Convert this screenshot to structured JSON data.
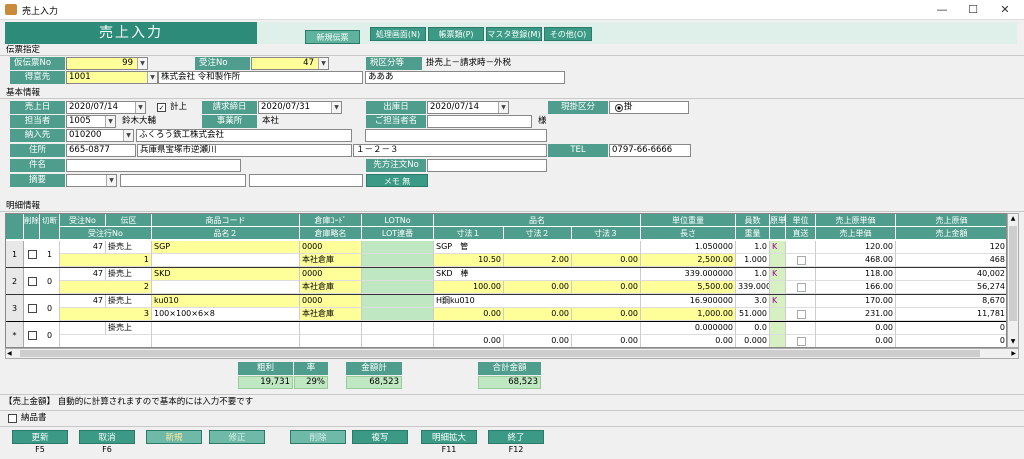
{
  "window": {
    "title": "売上入力",
    "minimize": "—",
    "maximize": "☐",
    "close": "✕"
  },
  "header": {
    "title": "売上入力",
    "new_badge": "新規伝票",
    "menu": [
      "処理画面(N)",
      "帳票類(P)",
      "マスタ登録(M)",
      "その他(O)"
    ]
  },
  "denpyo": {
    "section": "伝票指定",
    "karidenpyo_label": "仮伝票No",
    "karidenpyo_value": "99",
    "juchu_label": "受注No",
    "juchu_value": "47",
    "zeikubun_label": "税区分等",
    "zeikubun_value": "掛売上－請求時－外税",
    "tokuisaki_label": "得意先",
    "tokuisaki_code": "1001",
    "tokuisaki_name": "株式会社 令和製作所",
    "tokuisaki_extra": "あああ"
  },
  "kihon": {
    "section": "基本情報",
    "uriagebi_label": "売上日",
    "uriagebi": "2020/07/14",
    "keijo_label": "計上",
    "seikyu_label": "請求締日",
    "seikyu": "2020/07/31",
    "shukkobi_label": "出庫日",
    "shukkobi": "2020/07/14",
    "genkake_label": "現掛区分",
    "genkake_value": "掛",
    "tanto_label": "担当者",
    "tanto_code": "1005",
    "tanto_name": "鈴木大輔",
    "jigyosho_label": "事業所",
    "jigyosho": "本社",
    "gotanto_label": "ご担当者名",
    "sama": "様",
    "nonyu_label": "納入先",
    "nonyu_code": "010200",
    "nonyu_name": "ふくろう鉄工株式会社",
    "jusho_label": "住所",
    "zip": "665-0877",
    "addr1": "兵庫県宝塚市逆瀬川",
    "addr2": "１－２－３",
    "tel_label": "TEL",
    "tel": "0797-66-6666",
    "kenmei_label": "件名",
    "senpo_label": "先方注文No",
    "tekiyo_label": "摘要",
    "memo": "メモ 無"
  },
  "meisai": {
    "section": "明細情報",
    "headers_top": [
      "削除",
      "切断",
      "受注No",
      "伝区",
      "商品コード",
      "倉庫ｺｰﾄﾞ",
      "LOTNo",
      "品名",
      "単位重量",
      "員数",
      "原単",
      "単位",
      "売上原単価",
      "売上原価"
    ],
    "headers_bottom": [
      "受注行No",
      "品名２",
      "倉庫略名",
      "LOT連番",
      "寸法１",
      "寸法２",
      "寸法３",
      "長さ",
      "重量",
      "直送",
      "売上単価",
      "売上金額"
    ],
    "rows": [
      {
        "no": "1",
        "kiri": "1",
        "juchu": "47",
        "den": "掛売上",
        "code": "SGP",
        "soko": "0000",
        "hinmei": "SGP　管",
        "tanijuryo": "1.050000",
        "insu": "1.0",
        "gen": "K",
        "genka_tanka": "120.00",
        "genka": "120",
        "gyo": "1",
        "hinmei2": "",
        "soko_name": "本社倉庫",
        "s1": "10.50",
        "s2": "2.00",
        "s3": "0.00",
        "nagasa": "2,500.00",
        "juryo": "1.000",
        "tanka": "468.00",
        "kingaku": "468"
      },
      {
        "no": "2",
        "kiri": "0",
        "juchu": "47",
        "den": "掛売上",
        "code": "SKD",
        "soko": "0000",
        "hinmei": "SKD　棒",
        "tanijuryo": "339.000000",
        "insu": "1.0",
        "gen": "K",
        "genka_tanka": "118.00",
        "genka": "40,002",
        "gyo": "2",
        "hinmei2": "",
        "soko_name": "本社倉庫",
        "s1": "100.00",
        "s2": "0.00",
        "s3": "0.00",
        "nagasa": "5,500.00",
        "juryo": "339.000",
        "tanka": "166.00",
        "kingaku": "56,274"
      },
      {
        "no": "3",
        "kiri": "0",
        "juchu": "47",
        "den": "掛売上",
        "code": "ku010",
        "soko": "0000",
        "hinmei": "H鋼ku010",
        "tanijuryo": "16.900000",
        "insu": "3.0",
        "gen": "K",
        "genka_tanka": "170.00",
        "genka": "8,670",
        "gyo": "3",
        "hinmei2": "100×100×6×8",
        "soko_name": "本社倉庫",
        "s1": "0.00",
        "s2": "0.00",
        "s3": "0.00",
        "nagasa": "1,000.00",
        "juryo": "51.000",
        "tanka": "231.00",
        "kingaku": "11,781"
      },
      {
        "no": "*",
        "kiri": "0",
        "juchu": "",
        "den": "掛売上",
        "code": "",
        "soko": "",
        "hinmei": "",
        "tanijuryo": "0.000000",
        "insu": "0.0",
        "gen": "",
        "genka_tanka": "0.00",
        "genka": "0",
        "gyo": "",
        "hinmei2": "",
        "soko_name": "",
        "s1": "0.00",
        "s2": "0.00",
        "s3": "0.00",
        "nagasa": "0.00",
        "juryo": "0.000",
        "tanka": "0.00",
        "kingaku": "0"
      }
    ]
  },
  "totals": {
    "arari_label": "粗利",
    "arari": "19,731",
    "ritsu_label": "率",
    "ritsu": "29%",
    "kingaku_label": "金額計",
    "kingaku": "68,523",
    "gokei_label": "合計金額",
    "gokei": "68,523"
  },
  "status": {
    "message": "【売上金額】 自動的に計算されますので基本的には入力不要です",
    "nohinsho": "納品書"
  },
  "fkeys": [
    {
      "label": "更新",
      "key": "F5"
    },
    {
      "label": "取消",
      "key": "F6"
    },
    {
      "label": "新規",
      "key": ""
    },
    {
      "label": "修正",
      "key": ""
    },
    {
      "label": "削除",
      "key": ""
    },
    {
      "label": "複写",
      "key": ""
    },
    {
      "label": "明細拡大",
      "key": "F11"
    },
    {
      "label": "終了",
      "key": "F12"
    }
  ],
  "colors": {
    "accent": "#4f9e8d",
    "input_yellow": "#ffff99",
    "header_bar": "#2d8c79"
  }
}
